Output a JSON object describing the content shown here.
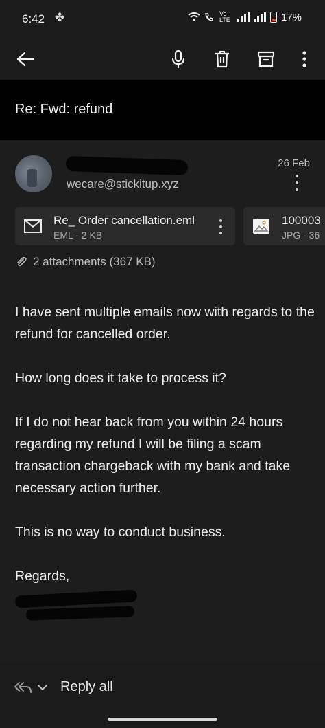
{
  "status_bar": {
    "time": "6:42",
    "network_label": "Vo LTE",
    "battery": "17%"
  },
  "toolbar": {
    "back_icon": "arrow-left-icon",
    "mic_icon": "microphone-icon",
    "delete_icon": "trash-icon",
    "archive_icon": "archive-icon",
    "more_icon": "more-vertical-icon"
  },
  "email": {
    "subject": "Re: Fwd: refund",
    "sender_email": "wecare@stickitup.xyz",
    "date": "26 Feb",
    "attachments": [
      {
        "name": "Re_ Order cancellation.eml",
        "meta": "EML - 2 KB",
        "icon": "envelope-icon"
      },
      {
        "name": "100003",
        "meta": "JPG - 36",
        "icon": "image-icon"
      }
    ],
    "attachments_summary": "2 attachments (367 KB)",
    "body": {
      "p1": "I have sent multiple emails now with regards to the refund for cancelled order.",
      "p2": "How long does it take to process it?",
      "p3": "If I do not hear back from you within 24 hours regarding my refund I will be filing a scam transaction chargeback with my bank and take necessary action further.",
      "p4": "This is no way to conduct business.",
      "closing": "Regards,"
    }
  },
  "bottom_bar": {
    "reply_label": "Reply all"
  },
  "colors": {
    "background": "#1d1d1d",
    "subject_bar": "#000000",
    "card": "#2a2a2a",
    "battery_low": "#e0472a"
  }
}
